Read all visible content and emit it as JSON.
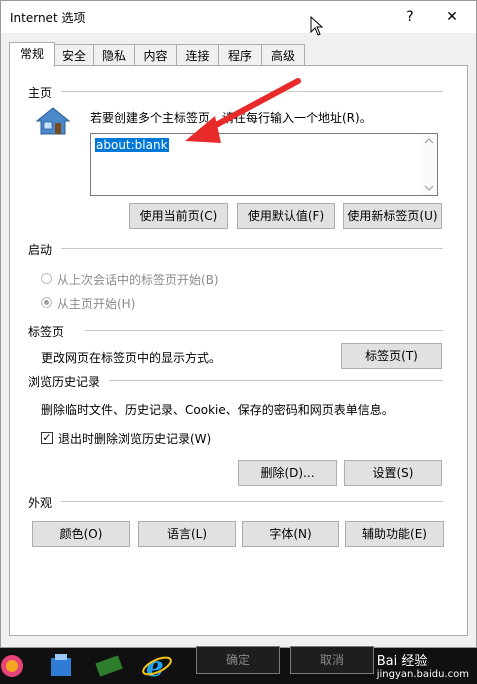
{
  "window": {
    "title": "Internet 选项",
    "help": "?",
    "close": "✕"
  },
  "tabs": [
    "常规",
    "安全",
    "隐私",
    "内容",
    "连接",
    "程序",
    "高级"
  ],
  "home": {
    "group": "主页",
    "instruction": "若要创建多个主标签页，请在每行输入一个地址(R)。",
    "url": "about:blank",
    "btn_current": "使用当前页(C)",
    "btn_default": "使用默认值(F)",
    "btn_newtab": "使用新标签页(U)"
  },
  "startup": {
    "group": "启动",
    "opt_last": "从上次会话中的标签页开始(B)",
    "opt_home": "从主页开始(H)"
  },
  "tabsgroup": {
    "group": "标签页",
    "desc": "更改网页在标签页中的显示方式。",
    "button": "标签页(T)"
  },
  "history": {
    "group": "浏览历史记录",
    "desc": "删除临时文件、历史记录、Cookie、保存的密码和网页表单信息。",
    "checkbox_checked": true,
    "checkbox_label": "退出时删除浏览历史记录(W)",
    "btn_delete": "删除(D)...",
    "btn_settings": "设置(S)"
  },
  "appearance": {
    "group": "外观",
    "btn_colors": "颜色(O)",
    "btn_language": "语言(L)",
    "btn_fonts": "字体(N)",
    "btn_accessibility": "辅助功能(E)"
  },
  "footer": {
    "ok": "确定",
    "cancel": "取消"
  },
  "watermark": {
    "brand": "Bai 经验",
    "url": "jingyan.baidu.com"
  },
  "annotation": {
    "arrow_color": "#e82a2a"
  }
}
